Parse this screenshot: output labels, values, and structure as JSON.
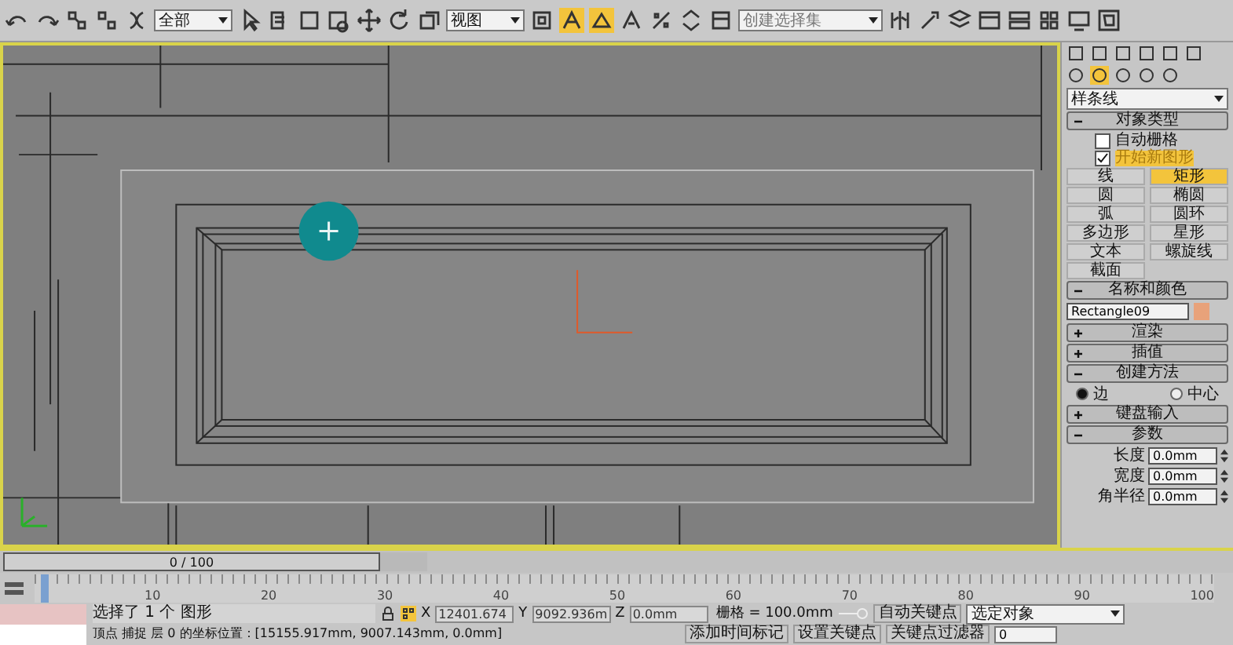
{
  "toolbar": {
    "selection_filter": "全部",
    "reference_coord": "视图",
    "named_selection": "创建选择集"
  },
  "viewport": {
    "active": true
  },
  "command_panel": {
    "category": "样条线",
    "rollouts": [
      {
        "kind": "object_type",
        "title": "对象类型",
        "expanded": true,
        "options": [
          {
            "label": "自动栅格",
            "checked": false
          },
          {
            "label": "开始新图形",
            "checked": true
          }
        ],
        "buttons": [
          {
            "label": "线",
            "selected": false
          },
          {
            "label": "矩形",
            "selected": true
          },
          {
            "label": "圆",
            "selected": false
          },
          {
            "label": "椭圆",
            "selected": false
          },
          {
            "label": "弧",
            "selected": false
          },
          {
            "label": "圆环",
            "selected": false
          },
          {
            "label": "多边形",
            "selected": false
          },
          {
            "label": "星形",
            "selected": false
          },
          {
            "label": "文本",
            "selected": false
          },
          {
            "label": "螺旋线",
            "selected": false
          },
          {
            "label": "截面",
            "selected": false
          }
        ]
      },
      {
        "kind": "name_color",
        "title": "名称和颜色",
        "expanded": true,
        "name": "Rectangle09",
        "color": "#e8a27a"
      },
      {
        "kind": "plain",
        "title": "渲染",
        "expanded": false
      },
      {
        "kind": "plain",
        "title": "插值",
        "expanded": false
      },
      {
        "kind": "radio",
        "title": "创建方法",
        "expanded": true,
        "options": [
          {
            "label": "边",
            "selected": true
          },
          {
            "label": "中心",
            "selected": false
          }
        ]
      },
      {
        "kind": "plain",
        "title": "键盘输入",
        "expanded": false
      },
      {
        "kind": "spinners",
        "title": "参数",
        "expanded": true,
        "fields": [
          {
            "label": "长度",
            "value": "0.0mm"
          },
          {
            "label": "宽度",
            "value": "0.0mm"
          },
          {
            "label": "角半径",
            "value": "0.0mm"
          }
        ]
      }
    ]
  },
  "time_slider": {
    "frame_display": "0 / 100",
    "level": 0
  },
  "ruler": {
    "ticks": [
      "10",
      "20",
      "30",
      "40",
      "50",
      "60",
      "70",
      "80",
      "90",
      "100"
    ]
  },
  "status_bar": {
    "selection": "选择了 1 个 图形",
    "coords": [
      {
        "axis": "X",
        "value": "12401.674"
      },
      {
        "axis": "Y",
        "value": "9092.936m"
      },
      {
        "axis": "Z",
        "value": "0.0mm"
      }
    ],
    "grid": "栅格 = 100.0mm",
    "prompt": "顶点 捕捉 层 0 的坐标位置：[15155.917mm, 9007.143mm, 0.0mm]",
    "add_time_tag": "添加时间标记",
    "auto_key": "自动关键点",
    "key_mode": "选定对象",
    "set_key": "设置关键点",
    "key_filters": "关键点过滤器",
    "frame": "0"
  }
}
